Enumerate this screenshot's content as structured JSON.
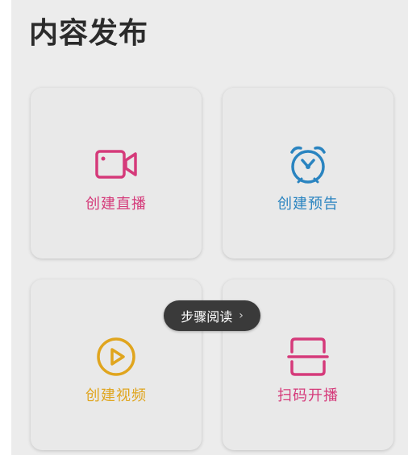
{
  "page": {
    "title": "内容发布"
  },
  "cards": [
    {
      "label": "创建直播",
      "icon": "video-camera-icon",
      "color": "#d53a7a"
    },
    {
      "label": "创建预告",
      "icon": "alarm-clock-icon",
      "color": "#2a84c0"
    },
    {
      "label": "创建视频",
      "icon": "play-circle-icon",
      "color": "#e0a51e"
    },
    {
      "label": "扫码开播",
      "icon": "scan-icon",
      "color": "#d53a7a"
    }
  ],
  "toast": {
    "label": "步骤阅读",
    "chevron": "›"
  }
}
